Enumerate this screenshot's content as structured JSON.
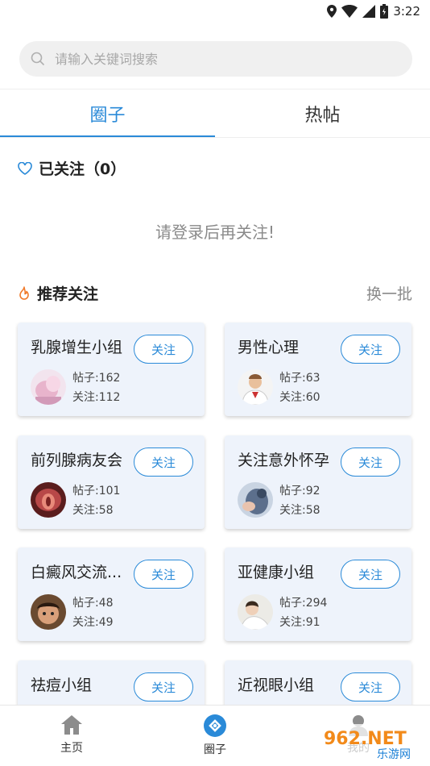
{
  "status": {
    "time": "3:22"
  },
  "search": {
    "placeholder": "请输入关键词搜索"
  },
  "tabs": [
    {
      "label": "圈子",
      "active": true
    },
    {
      "label": "热帖",
      "active": false
    }
  ],
  "followed": {
    "title": "已关注（0）",
    "empty_tip": "请登录后再关注!"
  },
  "recommend": {
    "title": "推荐关注",
    "swap_label": "换一批",
    "groups": [
      {
        "name": "乳腺增生小组",
        "follow_label": "关注",
        "posts": "帖子:162",
        "followers": "关注:112"
      },
      {
        "name": "男性心理",
        "follow_label": "关注",
        "posts": "帖子:63",
        "followers": "关注:60"
      },
      {
        "name": "前列腺病友会",
        "follow_label": "关注",
        "posts": "帖子:101",
        "followers": "关注:58"
      },
      {
        "name": "关注意外怀孕",
        "follow_label": "关注",
        "posts": "帖子:92",
        "followers": "关注:58"
      },
      {
        "name": "白癜风交流...",
        "follow_label": "关注",
        "posts": "帖子:48",
        "followers": "关注:49"
      },
      {
        "name": "亚健康小组",
        "follow_label": "关注",
        "posts": "帖子:294",
        "followers": "关注:91"
      },
      {
        "name": "祛痘小组",
        "follow_label": "关注",
        "posts": "",
        "followers": ""
      },
      {
        "name": "近视眼小组",
        "follow_label": "关注",
        "posts": "",
        "followers": ""
      }
    ]
  },
  "bottom_nav": [
    {
      "label": "主页",
      "icon": "home-icon",
      "active": false
    },
    {
      "label": "圈子",
      "icon": "circle-icon",
      "active": true
    },
    {
      "label": "我的",
      "icon": "user-icon",
      "active": false
    }
  ],
  "watermark": {
    "text": "962.NET",
    "subtext": "乐游网"
  },
  "colors": {
    "accent": "#2a8ad8",
    "card_bg": "#eef3fb",
    "fire": "#f07a2a"
  }
}
